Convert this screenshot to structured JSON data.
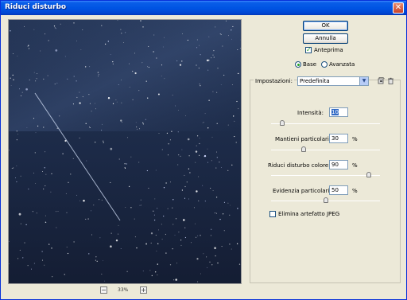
{
  "window": {
    "title": "Riduci disturbo",
    "close_glyph": "✕"
  },
  "preview": {
    "zoom": "33%",
    "zoom_out": "−",
    "zoom_in": "+"
  },
  "buttons": {
    "ok": "OK",
    "cancel": "Annulla"
  },
  "anteprima": {
    "label": "Anteprima",
    "checked": true
  },
  "mode": {
    "base": "Base",
    "advanced": "Avanzata",
    "selected": "base"
  },
  "settings": {
    "label": "Impostazioni:",
    "value": "Predefinita"
  },
  "controls": [
    {
      "label": "Intensità:",
      "value": "10",
      "unit": "",
      "percent": 10
    },
    {
      "label": "Mantieni particolari:",
      "value": "30",
      "unit": "%",
      "percent": 30
    },
    {
      "label": "Riduci disturbo colore:",
      "value": "90",
      "unit": "%",
      "percent": 90
    },
    {
      "label": "Evidenzia particolari:",
      "value": "50",
      "unit": "%",
      "percent": 50
    }
  ],
  "jpeg": {
    "label": "Elimina artefatto JPEG",
    "checked": false
  },
  "icons": [
    "save-settings-icon",
    "delete-settings-icon",
    "zoom-out-icon",
    "zoom-in-icon",
    "close-icon"
  ]
}
